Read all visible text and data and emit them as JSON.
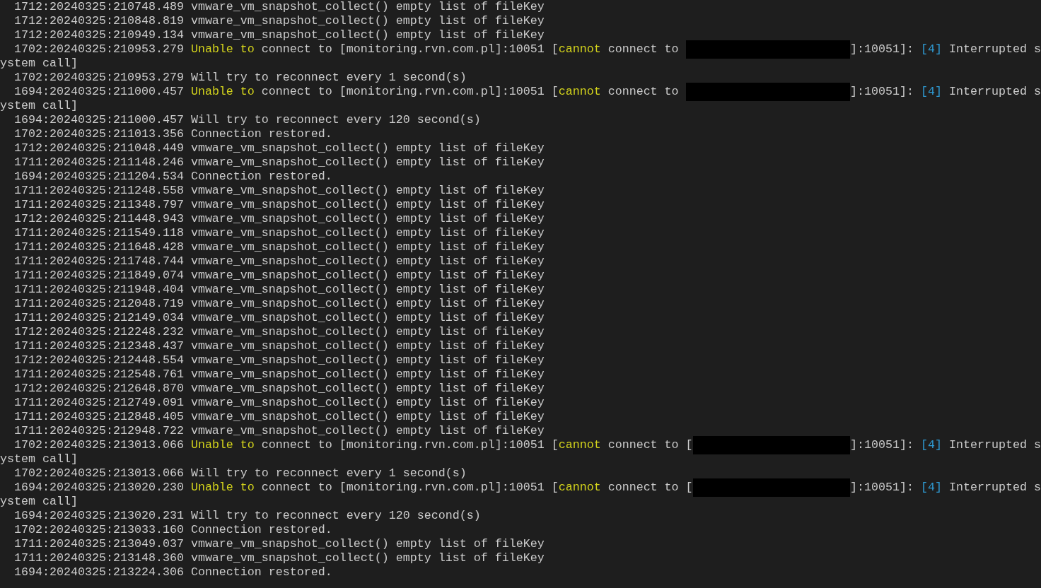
{
  "terminal": {
    "lines": [
      {
        "kind": "entry",
        "parts": [
          {
            "kind": "plain",
            "text": "1712:20240325:210748.489 vmware_vm_snapshot_collect() empty list of fileKey"
          }
        ]
      },
      {
        "kind": "entry",
        "parts": [
          {
            "kind": "plain",
            "text": "1712:20240325:210848.819 vmware_vm_snapshot_collect() empty list of fileKey"
          }
        ]
      },
      {
        "kind": "entry",
        "parts": [
          {
            "kind": "plain",
            "text": "1712:20240325:210949.134 vmware_vm_snapshot_collect() empty list of fileKey"
          }
        ]
      },
      {
        "kind": "entry",
        "parts": [
          {
            "kind": "plain",
            "text": "1702:20240325:210953.279 "
          },
          {
            "kind": "warn",
            "text": "Unable to"
          },
          {
            "kind": "plain",
            "text": " connect to [monitoring.rvn.com.pl]:10051 ["
          },
          {
            "kind": "warn",
            "text": "cannot"
          },
          {
            "kind": "plain",
            "text": " connect to "
          },
          {
            "kind": "redacted"
          },
          {
            "kind": "plain",
            "text": "]:10051]: "
          },
          {
            "kind": "info",
            "text": "[4]"
          },
          {
            "kind": "plain",
            "text": " Interrupted s"
          }
        ]
      },
      {
        "kind": "continuation",
        "parts": [
          {
            "kind": "plain",
            "text": "ystem call]"
          }
        ]
      },
      {
        "kind": "entry",
        "parts": [
          {
            "kind": "plain",
            "text": "1702:20240325:210953.279 Will try to reconnect every 1 second(s)"
          }
        ]
      },
      {
        "kind": "entry",
        "parts": [
          {
            "kind": "plain",
            "text": "1694:20240325:211000.457 "
          },
          {
            "kind": "warn",
            "text": "Unable to"
          },
          {
            "kind": "plain",
            "text": " connect to [monitoring.rvn.com.pl]:10051 ["
          },
          {
            "kind": "warn",
            "text": "cannot"
          },
          {
            "kind": "plain",
            "text": " connect to "
          },
          {
            "kind": "redacted"
          },
          {
            "kind": "plain",
            "text": "]:10051]: "
          },
          {
            "kind": "info",
            "text": "[4]"
          },
          {
            "kind": "plain",
            "text": " Interrupted s"
          }
        ]
      },
      {
        "kind": "continuation",
        "parts": [
          {
            "kind": "plain",
            "text": "ystem call]"
          }
        ]
      },
      {
        "kind": "entry",
        "parts": [
          {
            "kind": "plain",
            "text": "1694:20240325:211000.457 Will try to reconnect every 120 second(s)"
          }
        ]
      },
      {
        "kind": "entry",
        "parts": [
          {
            "kind": "plain",
            "text": "1702:20240325:211013.356 Connection restored."
          }
        ]
      },
      {
        "kind": "entry",
        "parts": [
          {
            "kind": "plain",
            "text": "1712:20240325:211048.449 vmware_vm_snapshot_collect() empty list of fileKey"
          }
        ]
      },
      {
        "kind": "entry",
        "parts": [
          {
            "kind": "plain",
            "text": "1711:20240325:211148.246 vmware_vm_snapshot_collect() empty list of fileKey"
          }
        ]
      },
      {
        "kind": "entry",
        "parts": [
          {
            "kind": "plain",
            "text": "1694:20240325:211204.534 Connection restored."
          }
        ]
      },
      {
        "kind": "entry",
        "parts": [
          {
            "kind": "plain",
            "text": "1711:20240325:211248.558 vmware_vm_snapshot_collect() empty list of fileKey"
          }
        ]
      },
      {
        "kind": "entry",
        "parts": [
          {
            "kind": "plain",
            "text": "1711:20240325:211348.797 vmware_vm_snapshot_collect() empty list of fileKey"
          }
        ]
      },
      {
        "kind": "entry",
        "parts": [
          {
            "kind": "plain",
            "text": "1712:20240325:211448.943 vmware_vm_snapshot_collect() empty list of fileKey"
          }
        ]
      },
      {
        "kind": "entry",
        "parts": [
          {
            "kind": "plain",
            "text": "1711:20240325:211549.118 vmware_vm_snapshot_collect() empty list of fileKey"
          }
        ]
      },
      {
        "kind": "entry",
        "parts": [
          {
            "kind": "plain",
            "text": "1711:20240325:211648.428 vmware_vm_snapshot_collect() empty list of fileKey"
          }
        ]
      },
      {
        "kind": "entry",
        "parts": [
          {
            "kind": "plain",
            "text": "1711:20240325:211748.744 vmware_vm_snapshot_collect() empty list of fileKey"
          }
        ]
      },
      {
        "kind": "entry",
        "parts": [
          {
            "kind": "plain",
            "text": "1711:20240325:211849.074 vmware_vm_snapshot_collect() empty list of fileKey"
          }
        ]
      },
      {
        "kind": "entry",
        "parts": [
          {
            "kind": "plain",
            "text": "1711:20240325:211948.404 vmware_vm_snapshot_collect() empty list of fileKey"
          }
        ]
      },
      {
        "kind": "entry",
        "parts": [
          {
            "kind": "plain",
            "text": "1711:20240325:212048.719 vmware_vm_snapshot_collect() empty list of fileKey"
          }
        ]
      },
      {
        "kind": "entry",
        "parts": [
          {
            "kind": "plain",
            "text": "1711:20240325:212149.034 vmware_vm_snapshot_collect() empty list of fileKey"
          }
        ]
      },
      {
        "kind": "entry",
        "parts": [
          {
            "kind": "plain",
            "text": "1712:20240325:212248.232 vmware_vm_snapshot_collect() empty list of fileKey"
          }
        ]
      },
      {
        "kind": "entry",
        "parts": [
          {
            "kind": "plain",
            "text": "1711:20240325:212348.437 vmware_vm_snapshot_collect() empty list of fileKey"
          }
        ]
      },
      {
        "kind": "entry",
        "parts": [
          {
            "kind": "plain",
            "text": "1712:20240325:212448.554 vmware_vm_snapshot_collect() empty list of fileKey"
          }
        ]
      },
      {
        "kind": "entry",
        "parts": [
          {
            "kind": "plain",
            "text": "1711:20240325:212548.761 vmware_vm_snapshot_collect() empty list of fileKey"
          }
        ]
      },
      {
        "kind": "entry",
        "parts": [
          {
            "kind": "plain",
            "text": "1712:20240325:212648.870 vmware_vm_snapshot_collect() empty list of fileKey"
          }
        ]
      },
      {
        "kind": "entry",
        "parts": [
          {
            "kind": "plain",
            "text": "1711:20240325:212749.091 vmware_vm_snapshot_collect() empty list of fileKey"
          }
        ]
      },
      {
        "kind": "entry",
        "parts": [
          {
            "kind": "plain",
            "text": "1711:20240325:212848.405 vmware_vm_snapshot_collect() empty list of fileKey"
          }
        ]
      },
      {
        "kind": "entry",
        "parts": [
          {
            "kind": "plain",
            "text": "1711:20240325:212948.722 vmware_vm_snapshot_collect() empty list of fileKey"
          }
        ]
      },
      {
        "kind": "entry",
        "parts": [
          {
            "kind": "plain",
            "text": "1702:20240325:213013.066 "
          },
          {
            "kind": "warn",
            "text": "Unable to"
          },
          {
            "kind": "plain",
            "text": " connect to [monitoring.rvn.com.pl]:10051 ["
          },
          {
            "kind": "warn",
            "text": "cannot"
          },
          {
            "kind": "plain",
            "text": " connect to ["
          },
          {
            "kind": "redacted"
          },
          {
            "kind": "plain",
            "text": "]:10051]: "
          },
          {
            "kind": "info",
            "text": "[4]"
          },
          {
            "kind": "plain",
            "text": " Interrupted s"
          }
        ]
      },
      {
        "kind": "continuation",
        "parts": [
          {
            "kind": "plain",
            "text": "ystem call]"
          }
        ]
      },
      {
        "kind": "entry",
        "parts": [
          {
            "kind": "plain",
            "text": "1702:20240325:213013.066 Will try to reconnect every 1 second(s)"
          }
        ]
      },
      {
        "kind": "entry",
        "parts": [
          {
            "kind": "plain",
            "text": "1694:20240325:213020.230 "
          },
          {
            "kind": "warn",
            "text": "Unable to"
          },
          {
            "kind": "plain",
            "text": " connect to [monitoring.rvn.com.pl]:10051 ["
          },
          {
            "kind": "warn",
            "text": "cannot"
          },
          {
            "kind": "plain",
            "text": " connect to ["
          },
          {
            "kind": "redacted"
          },
          {
            "kind": "plain",
            "text": "]:10051]: "
          },
          {
            "kind": "info",
            "text": "[4]"
          },
          {
            "kind": "plain",
            "text": " Interrupted s"
          }
        ]
      },
      {
        "kind": "continuation",
        "parts": [
          {
            "kind": "plain",
            "text": "ystem call]"
          }
        ]
      },
      {
        "kind": "entry",
        "parts": [
          {
            "kind": "plain",
            "text": "1694:20240325:213020.231 Will try to reconnect every 120 second(s)"
          }
        ]
      },
      {
        "kind": "entry",
        "parts": [
          {
            "kind": "plain",
            "text": "1702:20240325:213033.160 Connection restored."
          }
        ]
      },
      {
        "kind": "entry",
        "parts": [
          {
            "kind": "plain",
            "text": "1711:20240325:213049.037 vmware_vm_snapshot_collect() empty list of fileKey"
          }
        ]
      },
      {
        "kind": "entry",
        "parts": [
          {
            "kind": "plain",
            "text": "1711:20240325:213148.360 vmware_vm_snapshot_collect() empty list of fileKey"
          }
        ]
      },
      {
        "kind": "entry",
        "parts": [
          {
            "kind": "plain",
            "text": "1694:20240325:213224.306 Connection restored."
          }
        ]
      }
    ]
  }
}
